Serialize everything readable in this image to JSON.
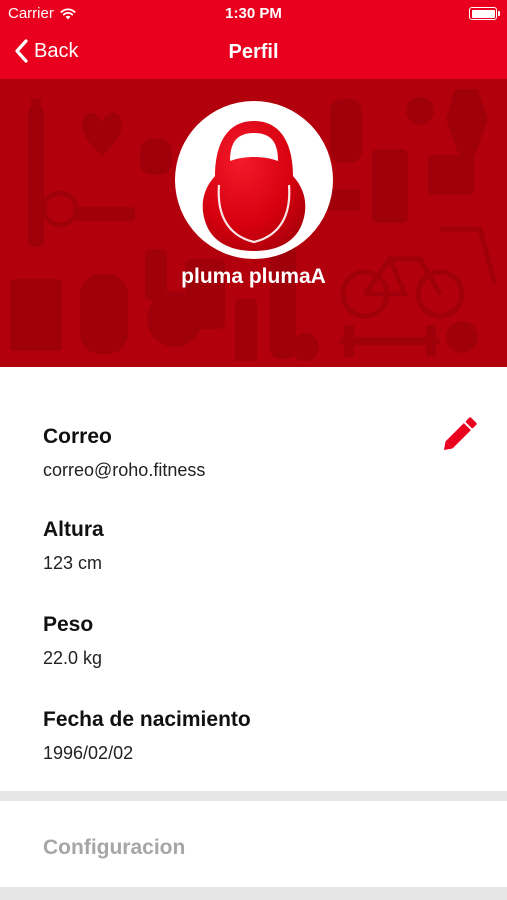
{
  "status_bar": {
    "carrier": "Carrier",
    "time": "1:30 PM"
  },
  "nav": {
    "back_label": "Back",
    "title": "Perfil"
  },
  "profile": {
    "name": "pluma plumaA"
  },
  "fields": [
    {
      "label": "Correo",
      "value": "correo@roho.fitness"
    },
    {
      "label": "Altura",
      "value": "123 cm"
    },
    {
      "label": "Peso",
      "value": "22.0 kg"
    },
    {
      "label": "Fecha de nacimiento",
      "value": "1996/02/02"
    }
  ],
  "settings": {
    "label": "Configuracion"
  },
  "colors": {
    "brand_red": "#e8001e",
    "hero_red": "#b3000d",
    "muted_text": "#a6a6a6"
  },
  "icons": {
    "back": "chevron-left-icon",
    "edit": "pencil-icon",
    "wifi": "wifi-icon",
    "battery": "battery-icon",
    "avatar": "kettlebell-icon"
  }
}
